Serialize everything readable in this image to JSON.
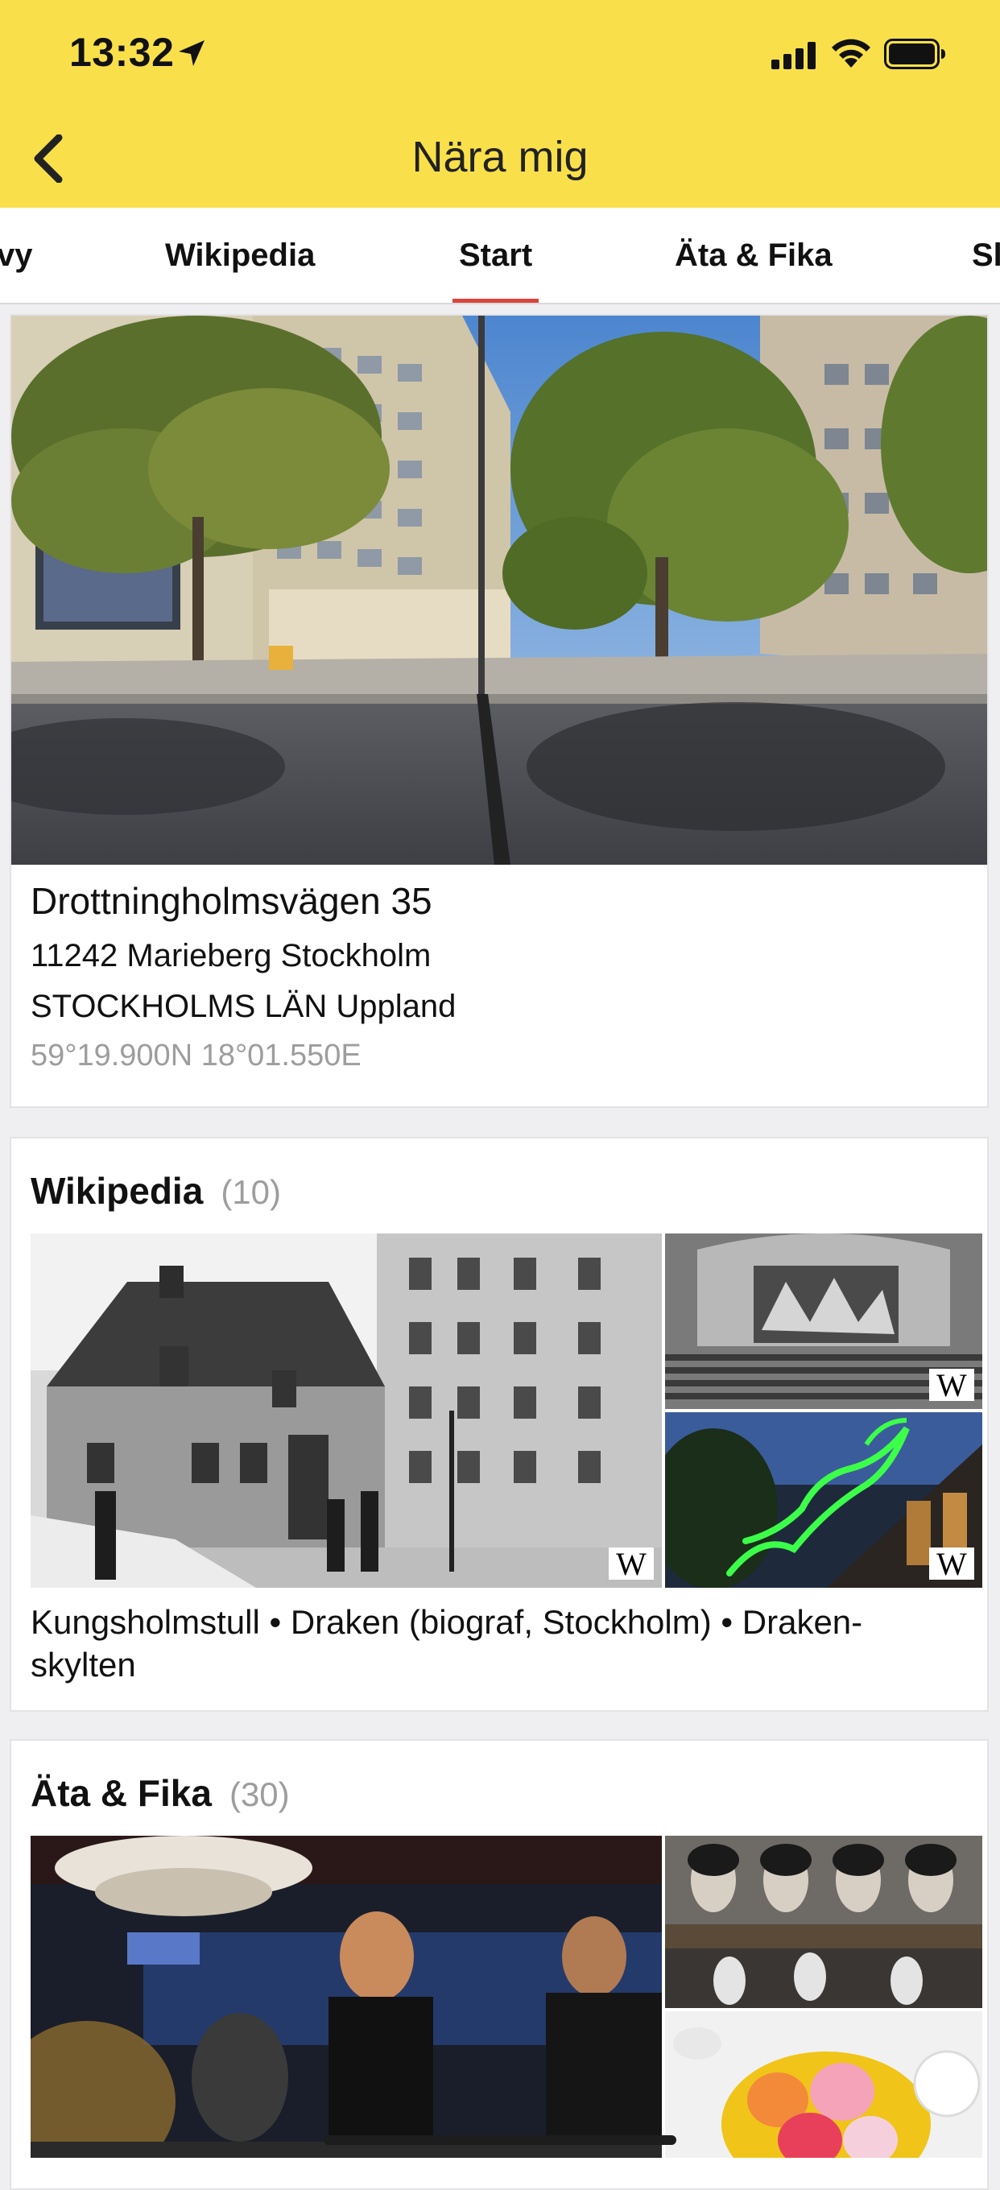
{
  "status_bar": {
    "time": "13:32",
    "icons": [
      "location-arrow-icon",
      "cellular-signal-icon",
      "wifi-icon",
      "battery-icon"
    ]
  },
  "header": {
    "title": "Nära mig",
    "back_icon": "chevron-left-icon",
    "background": "#f9e04b"
  },
  "tabs": [
    {
      "label": "vy",
      "active": false
    },
    {
      "label": "Wikipedia",
      "active": false
    },
    {
      "label": "Start",
      "active": true
    },
    {
      "label": "Äta & Fika",
      "active": false
    },
    {
      "label": "Sl",
      "active": false
    }
  ],
  "tab_indicator_color": "#d9453c",
  "location_card": {
    "street": "Drottningholmsvägen 35",
    "postal_city": "11242 Marieberg Stockholm",
    "region": "STOCKHOLMS LÄN Uppland",
    "coordinates": "59°19.900N 18°01.550E"
  },
  "wikipedia_section": {
    "title": "Wikipedia",
    "count": "(10)",
    "badge": "W",
    "description": "Kungsholmstull • Draken (biograf, Stockholm) • Draken-skylten"
  },
  "food_section": {
    "title": "Äta & Fika",
    "count": "(30)"
  }
}
